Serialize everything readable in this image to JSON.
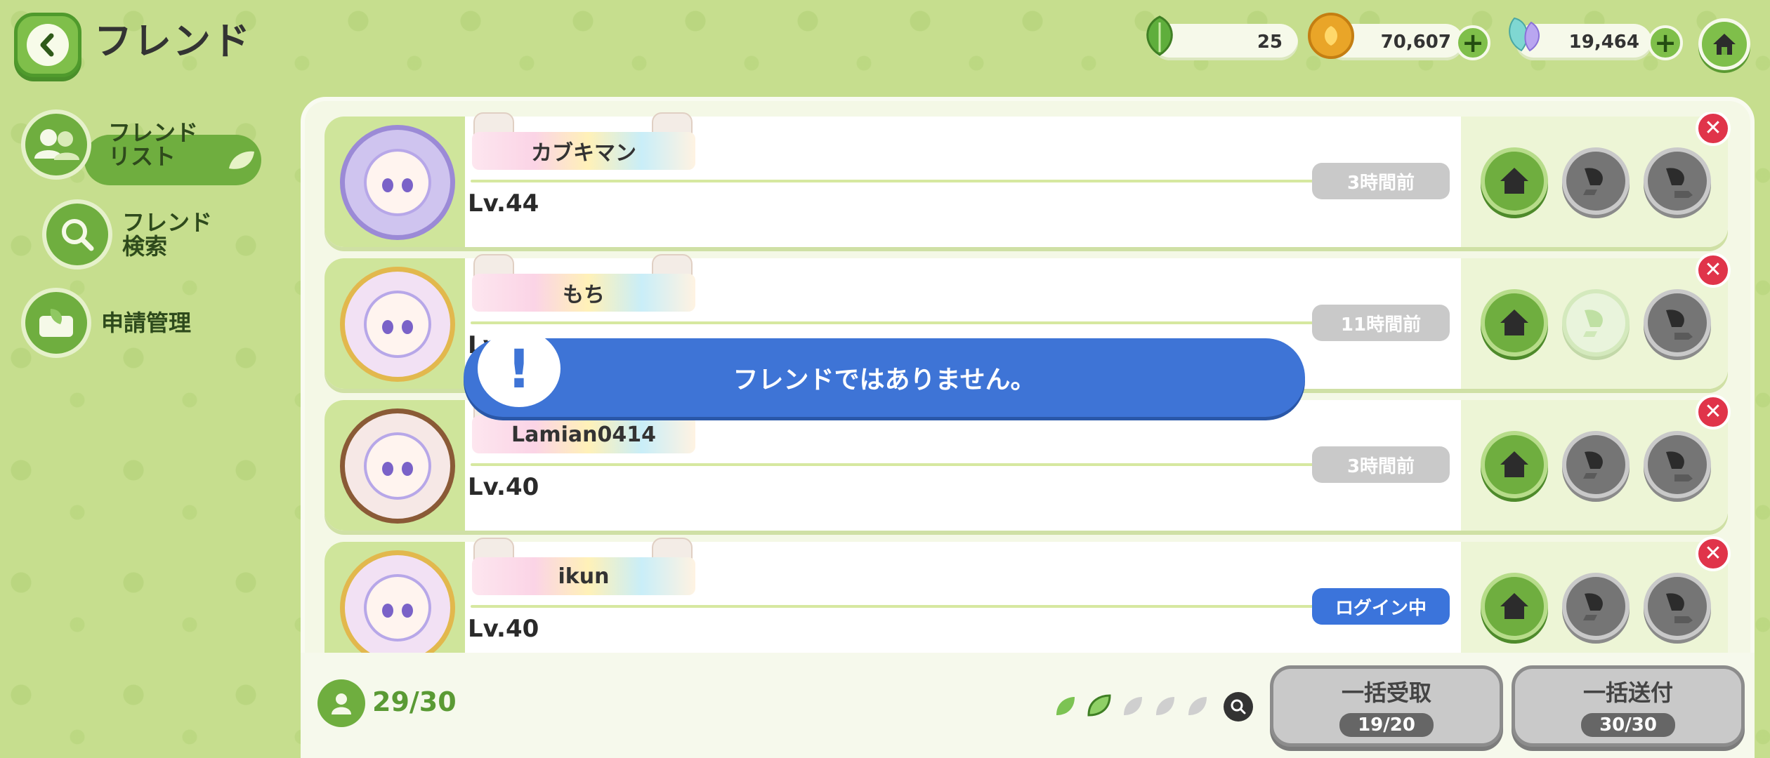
{
  "header": {
    "title": "フレンド",
    "resources": [
      {
        "name": "leaf-stamina",
        "icon": "leaf-icon",
        "value": "25"
      },
      {
        "name": "coins",
        "icon": "coin-icon",
        "value": "70,607"
      },
      {
        "name": "crystals",
        "icon": "crystal-leaf-icon",
        "value": "19,464"
      }
    ]
  },
  "nav": {
    "items": [
      {
        "label_l1": "フレンド",
        "label_l2": "リスト",
        "icon": "friends-icon",
        "active": true
      },
      {
        "label_l1": "フレンド",
        "label_l2": "検索",
        "icon": "search-icon",
        "active": false
      },
      {
        "label_l1": "申請管理",
        "label_l2": "",
        "icon": "request-icon",
        "active": false
      }
    ]
  },
  "friends": [
    {
      "name": "カブキマン",
      "level": "Lv.44",
      "last_login": "3時間前",
      "online": false,
      "gift_received": false
    },
    {
      "name": "もち",
      "level": "Lv.4",
      "last_login": "11時間前",
      "online": false,
      "gift_received": true
    },
    {
      "name": "Lamian0414",
      "level": "Lv.40",
      "last_login": "3時間前",
      "online": false,
      "gift_received": false
    },
    {
      "name": "ikun",
      "level": "Lv.40",
      "last_login": "ログイン中",
      "online": true,
      "gift_received": false
    }
  ],
  "toast": {
    "message": "フレンドではありません。",
    "icon_text": "!"
  },
  "footer": {
    "friend_count": "29/30",
    "bulk_receive": {
      "label": "一括受取",
      "count": "19/20"
    },
    "bulk_send": {
      "label": "一括送付",
      "count": "30/30"
    }
  },
  "colors": {
    "background": "#c6de8e",
    "accent_green": "#6fae3f",
    "toast_blue": "#3e74d6",
    "close_red": "#e0344a",
    "online_blue": "#3b74db"
  }
}
